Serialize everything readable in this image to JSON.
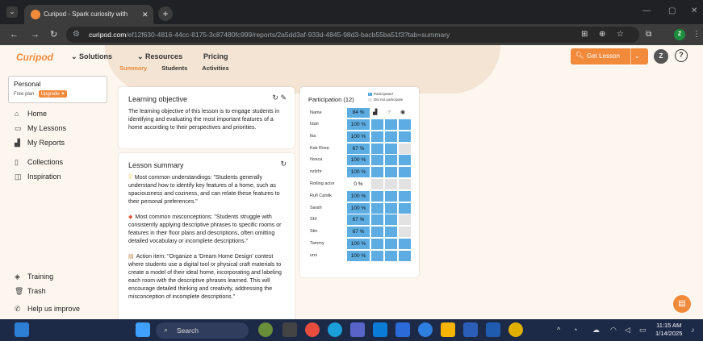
{
  "browser": {
    "tab_title": "Curipod - Spark curiosity with",
    "tab_close": "✕",
    "new_tab": "+",
    "url_host": "curipod.com",
    "url_path": "/ef12f630-4816-44cc-8175-3c87480fc999/reports/2a5dd3af-933d-4845-98d3-bacb55ba51f3?tab=summary",
    "profile_initial": "Z"
  },
  "app": {
    "logo": "Curipod",
    "nav": [
      "Solutions",
      "Resources",
      "Pricing"
    ],
    "get_lesson": "Get Lesson",
    "avatar": "Z",
    "help": "?",
    "subtabs": [
      "Summary",
      "Students",
      "Activities"
    ]
  },
  "sidebar": {
    "plan_name": "Personal",
    "plan_line": "Free plan ·",
    "upgrade": "Upgrade ✦",
    "items": [
      {
        "label": "Home",
        "icon": "home-icon"
      },
      {
        "label": "My Lessons",
        "icon": "folder-icon"
      },
      {
        "label": "My Reports",
        "icon": "reports-icon"
      },
      {
        "label": "Collections",
        "icon": "collections-icon"
      },
      {
        "label": "Inspiration",
        "icon": "inspiration-icon"
      },
      {
        "label": "Training",
        "icon": "training-icon"
      },
      {
        "label": "Trash",
        "icon": "trash-icon"
      },
      {
        "label": "Help us improve",
        "icon": "feedback-icon"
      }
    ]
  },
  "objective": {
    "title": "Learning objective",
    "text": "The learning objective of this lesson is to engage students in identifying and evaluating the most important features of a home according to their perspectives and priorities."
  },
  "summary": {
    "title": "Lesson summary",
    "understandings": "Most common understandings: \"Students generally understand how to identify key features of a home, such as spaciousness and coziness, and can relate these features to their personal preferences.\"",
    "misconceptions": "Most common misconceptions: \"Students struggle with consistently applying descriptive phrases to specific rooms or features in their floor plans and descriptions, often omitting detailed vocabulary or incomplete descriptions.\"",
    "action": "Action item: \"Organize a 'Dream Home Design' contest where students use a digital tool or physical craft materials to create a model of their ideal home, incorporating and labeling each room with the descriptive phrases learned. This will encourage detailed thinking and creativity, addressing the misconception of incomplete descriptions.\""
  },
  "participation": {
    "title": "Participation (12)",
    "legend_participated": "Participated",
    "legend_not": "Did not participate",
    "color_participated": "#5dade2",
    "color_not": "#e2e2e2",
    "header_name": "Name",
    "header_pct": "84 %",
    "rows": [
      {
        "name": "Idah",
        "pct": "100 %",
        "cells": [
          1,
          1,
          1
        ]
      },
      {
        "name": "Ika",
        "pct": "100 %",
        "cells": [
          1,
          1,
          1
        ]
      },
      {
        "name": "Kak Rose",
        "pct": "67 %",
        "cells": [
          1,
          1,
          0
        ]
      },
      {
        "name": "Nssca",
        "pct": "100 %",
        "cells": [
          1,
          1,
          1
        ]
      },
      {
        "name": "nzlzhr",
        "pct": "100 %",
        "cells": [
          1,
          1,
          1
        ]
      },
      {
        "name": "Rolling actor",
        "pct": "0 %",
        "cells": [
          0,
          0,
          0
        ]
      },
      {
        "name": "Rufi Cantik",
        "pct": "100 %",
        "cells": [
          1,
          1,
          1
        ]
      },
      {
        "name": "Sarah",
        "pct": "100 %",
        "cells": [
          1,
          1,
          1
        ]
      },
      {
        "name": "Shf",
        "pct": "67 %",
        "cells": [
          1,
          1,
          0
        ]
      },
      {
        "name": "Stin",
        "pct": "67 %",
        "cells": [
          1,
          1,
          0
        ]
      },
      {
        "name": "Tammy",
        "pct": "100 %",
        "cells": [
          1,
          1,
          1
        ]
      },
      {
        "name": "umi",
        "pct": "100 %",
        "cells": [
          1,
          1,
          1
        ]
      }
    ]
  },
  "taskbar": {
    "search": "Search",
    "time": "11:15 AM",
    "date": "1/14/2025"
  }
}
